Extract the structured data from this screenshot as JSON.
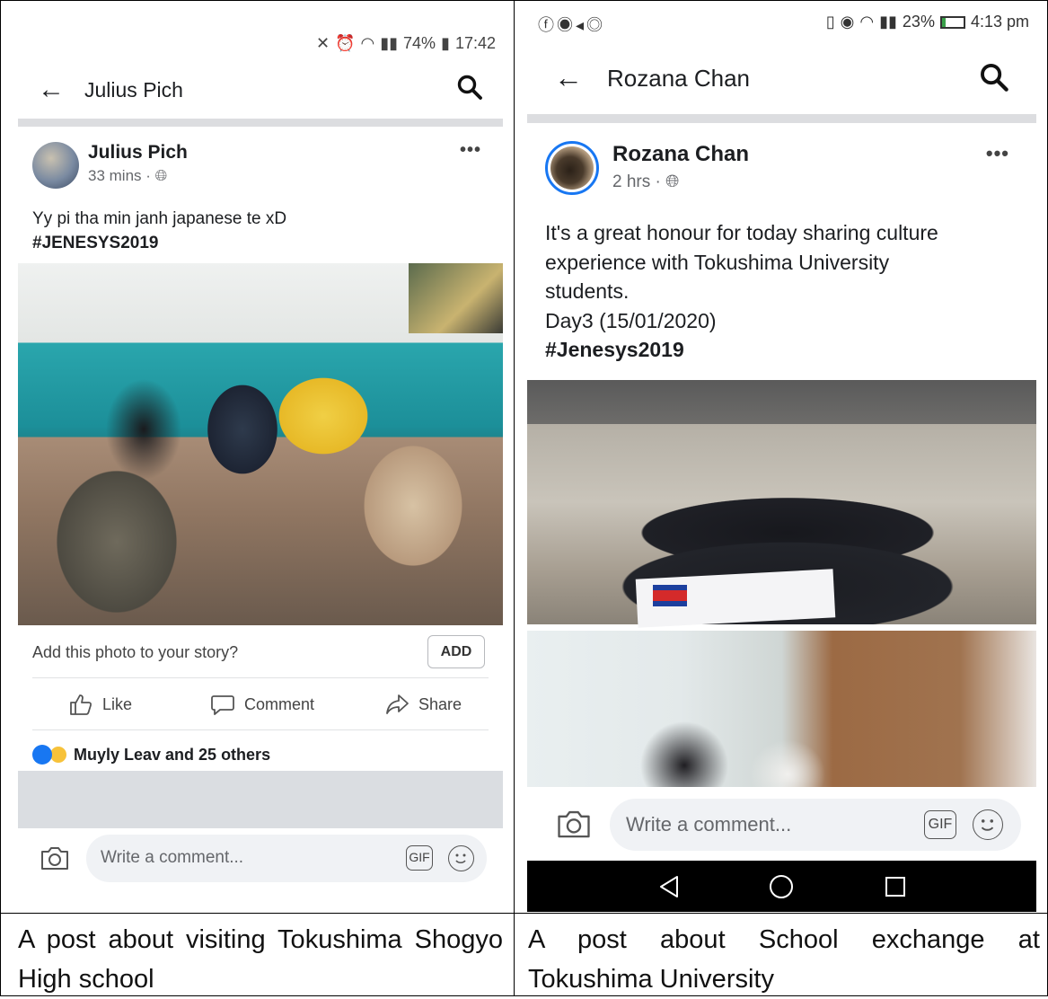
{
  "left_post": {
    "status_bar": {
      "battery": "74%",
      "time": "17:42"
    },
    "header": {
      "title": "Julius Pich"
    },
    "author": "Julius Pich",
    "meta": "33 mins · ",
    "text_line1": "Yy pi tha min janh japanese te xD",
    "hashtag": "#JENESYS2019",
    "story_prompt": "Add this photo to your story?",
    "add_label": "ADD",
    "actions": {
      "like": "Like",
      "comment": "Comment",
      "share": "Share"
    },
    "reactions_text": "Muyly Leav and 25 others",
    "comment_placeholder": "Write a comment...",
    "gif_label": "GIF"
  },
  "right_post": {
    "status_bar": {
      "battery": "23%",
      "time": "4:13 pm"
    },
    "header": {
      "title": "Rozana Chan"
    },
    "author": "Rozana Chan",
    "meta": "2 hrs · ",
    "text_line1": "It's a great honour for today sharing culture",
    "text_line2": "experience with Tokushima University",
    "text_line3": "students.",
    "text_line4": "Day3 (15/01/2020)",
    "hashtag": "#Jenesys2019",
    "comment_placeholder": "Write a comment...",
    "gif_label": "GIF"
  },
  "captions": {
    "left": "A post about visiting Tokushima Shogyo High school",
    "right": "A post about School exchange at Tokushima University"
  },
  "colors": {
    "facebook_blue": "#1877f2",
    "haha_yellow": "#f7c23a",
    "divider": "#dcdde0",
    "navbar": "#000000"
  }
}
